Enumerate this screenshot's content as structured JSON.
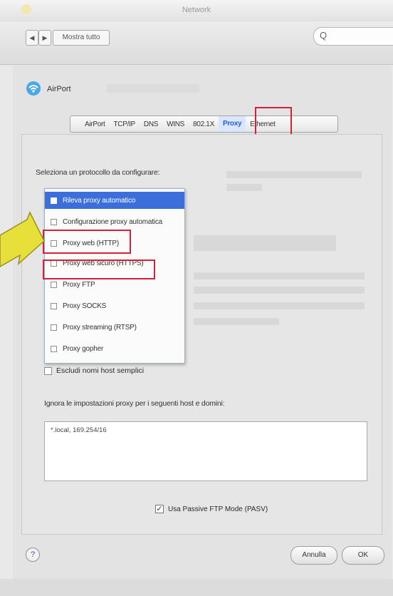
{
  "window": {
    "title": "Network"
  },
  "toolbar": {
    "back_label": "◀",
    "forward_label": "▶",
    "show_all_label": "Mostra tutto",
    "search_icon": "Q"
  },
  "network": {
    "name": "AirPort",
    "icon": "wifi-icon"
  },
  "tabs": [
    {
      "label": "AirPort"
    },
    {
      "label": "TCP/IP"
    },
    {
      "label": "DNS"
    },
    {
      "label": "WINS"
    },
    {
      "label": "802.1X"
    },
    {
      "label": "Proxy"
    },
    {
      "label": "Ethernet"
    }
  ],
  "protocol_label": "Seleziona un protocollo da configurare:",
  "protocols": [
    {
      "label": "Rileva proxy automatico",
      "selected": true
    },
    {
      "label": "Configurazione proxy automatica",
      "selected": false
    },
    {
      "label": "Proxy web (HTTP)",
      "selected": false
    },
    {
      "label": "Proxy web sicuro (HTTPS)",
      "selected": false
    },
    {
      "label": "Proxy FTP",
      "selected": false
    },
    {
      "label": "Proxy SOCKS",
      "selected": false
    },
    {
      "label": "Proxy streaming (RTSP)",
      "selected": false
    },
    {
      "label": "Proxy gopher",
      "selected": false
    }
  ],
  "exclude_label": "Escludi nomi host semplici",
  "ignore_label": "Ignora le impostazioni proxy per i seguenti host e domini:",
  "bypass_value": "*.local, 169.254/16",
  "pasv_label": "Usa Passive FTP Mode (PASV)",
  "pasv_checked": true,
  "help_label": "?",
  "cancel_label": "Annulla",
  "ok_label": "OK",
  "colors": {
    "highlight": "#d4213a",
    "selection": "#3c6fdb",
    "arrow": "#e8e03a"
  }
}
